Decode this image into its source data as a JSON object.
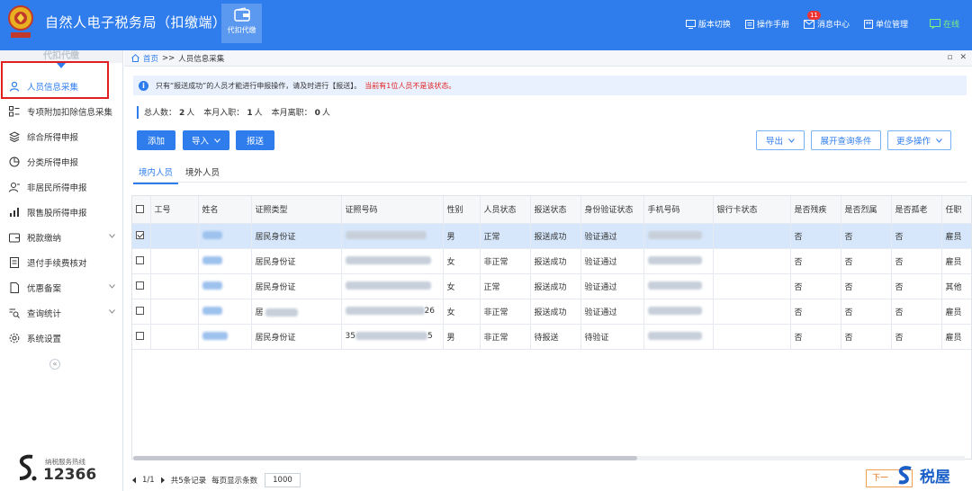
{
  "header": {
    "title": "自然人电子税务局（扣缴端）",
    "module_tab": "代扣代缴",
    "toolbar": [
      {
        "label": "版本切换",
        "icon": "monitor-icon"
      },
      {
        "label": "操作手册",
        "icon": "manual-icon"
      },
      {
        "label": "消息中心",
        "icon": "mail-icon",
        "badge": "11"
      },
      {
        "label": "单位管理",
        "icon": "building-icon"
      },
      {
        "label": "在线",
        "icon": "chat-online-icon"
      }
    ],
    "accent_color": "#2f7ded"
  },
  "sidebar": {
    "header_label": "代扣代缴",
    "items": [
      {
        "label": "人员信息采集",
        "icon": "person-icon",
        "active": true
      },
      {
        "label": "专项附加扣除信息采集",
        "icon": "list-grid-icon"
      },
      {
        "label": "综合所得申报",
        "icon": "layers-icon"
      },
      {
        "label": "分类所得申报",
        "icon": "pie-icon"
      },
      {
        "label": "非居民所得申报",
        "icon": "person-add-icon"
      },
      {
        "label": "限售股所得申报",
        "icon": "bar-chart-icon"
      },
      {
        "label": "税款缴纳",
        "icon": "wallet-icon",
        "expandable": true
      },
      {
        "label": "退付手续费核对",
        "icon": "receipt-icon"
      },
      {
        "label": "优惠备案",
        "icon": "document-icon",
        "expandable": true
      },
      {
        "label": "查询统计",
        "icon": "search-list-icon",
        "expandable": true
      },
      {
        "label": "系统设置",
        "icon": "gear-icon"
      }
    ],
    "collapse_label": "«",
    "hotline_label": "纳税服务热线",
    "hotline_number": "12366"
  },
  "breadcrumb": {
    "home": "首页",
    "separator": ">>",
    "current": "人员信息采集"
  },
  "notice": {
    "icon": "i",
    "text": "只有“报送成功”的人员才能进行申报操作，请及时进行【报送】。",
    "warning": "当前有1位人员不是该状态。"
  },
  "stats": {
    "total_label": "总人数：",
    "total_value": "2",
    "joined_label": "本月入职：",
    "joined_value": "1",
    "left_label": "本月离职：",
    "left_value": "0",
    "unit": "人"
  },
  "actions": {
    "add": "添加",
    "import": "导入",
    "submit": "报送",
    "export": "导出",
    "expand_query": "展开查询条件",
    "more": "更多操作"
  },
  "tabs": [
    "境内人员",
    "境外人员"
  ],
  "table": {
    "columns": [
      "工号",
      "姓名",
      "证照类型",
      "证照号码",
      "性别",
      "人员状态",
      "报送状态",
      "身份验证状态",
      "手机号码",
      "银行卡状态",
      "是否残疾",
      "是否烈属",
      "是否孤老",
      "任职"
    ],
    "rows": [
      {
        "checked": true,
        "id_type": "居民身份证",
        "gender": "男",
        "status": "正常",
        "submit_status": "报送成功",
        "verify": "验证通过",
        "disabled": "否",
        "martyr": "否",
        "elder": "否",
        "employ": "雇员"
      },
      {
        "checked": false,
        "id_type": "居民身份证",
        "gender": "女",
        "status": "非正常",
        "submit_status": "报送成功",
        "verify": "验证通过",
        "disabled": "否",
        "martyr": "否",
        "elder": "否",
        "employ": "雇员"
      },
      {
        "checked": false,
        "id_type": "居民身份证",
        "gender": "女",
        "status": "正常",
        "submit_status": "报送成功",
        "verify": "验证通过",
        "disabled": "否",
        "martyr": "否",
        "elder": "否",
        "employ": "其他"
      },
      {
        "checked": false,
        "id_type": "居",
        "id_tail": "26",
        "gender": "女",
        "status": "非正常",
        "submit_status": "报送成功",
        "verify": "验证通过",
        "disabled": "否",
        "martyr": "否",
        "elder": "否",
        "employ": "雇员"
      },
      {
        "checked": false,
        "id_type": "居民身份证",
        "id_head": "35",
        "id_tail": "5",
        "gender": "男",
        "status": "非正常",
        "submit_status": "待报送",
        "verify": "待验证",
        "disabled": "否",
        "martyr": "否",
        "elder": "否",
        "employ": "雇员"
      }
    ]
  },
  "pager": {
    "page": "1/1",
    "total": "共5条记录",
    "per_page_label": "每页显示条数",
    "per_page": "1000"
  },
  "next_button": "下一",
  "watermark": "税屋"
}
